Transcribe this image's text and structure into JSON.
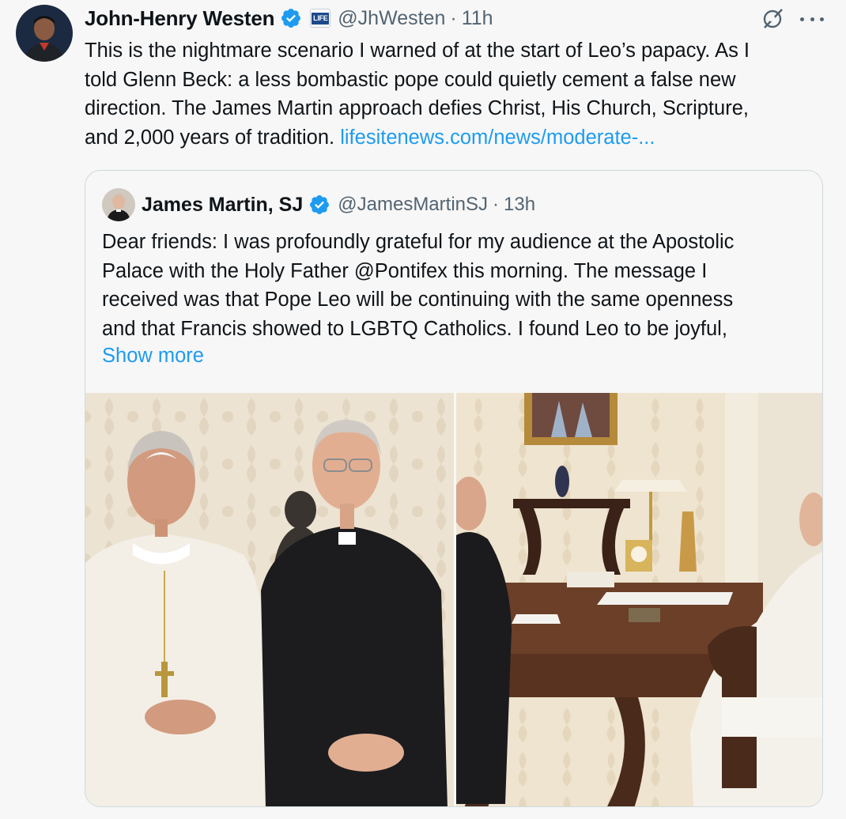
{
  "tweet": {
    "author_name": "John-Henry Westen",
    "affiliate_badge": "LIFE",
    "handle": "@JhWesten",
    "separator": "·",
    "time": "11h",
    "text_lines": [
      "This is the nightmare scenario I warned of at the start of Leo’s papacy. As I",
      "told Glenn Beck: a less bombastic pope could quietly cement a false new",
      "direction. The James Martin approach defies Christ, His Church, Scripture,"
    ],
    "text_last": "and 2,000 years of tradition. ",
    "link": "lifesitenews.com/news/moderate-..."
  },
  "quote": {
    "author_name": "James Martin, SJ",
    "handle": "@JamesMartinSJ",
    "separator": "·",
    "time": "13h",
    "text_lines": [
      "Dear friends: I was profoundly grateful for my audience at the Apostolic",
      "Palace with the Holy Father @Pontifex  this morning. The message I",
      "received was that Pope Leo will be continuing with the same openness",
      "and that Francis showed to LGBTQ Catholics. I found Leo to be joyful,"
    ],
    "show_more": "Show more"
  },
  "icons": {
    "verified": "verified-checkmark-icon",
    "grok": "grok-icon",
    "more": "more-options-icon"
  },
  "colors": {
    "link": "#1d9bf0",
    "verified": "#1d9bf0",
    "muted_text": "#536471",
    "background": "#f7f7f7"
  }
}
